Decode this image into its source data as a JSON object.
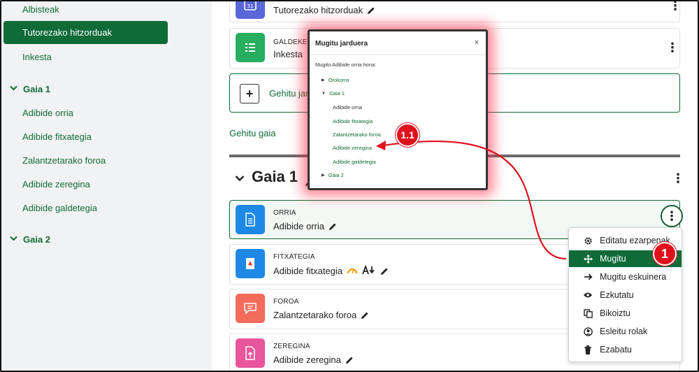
{
  "sidebar": {
    "items": [
      {
        "label": "Albisteak"
      },
      {
        "label": "Tutorezako hitzorduak"
      },
      {
        "label": "Inkesta"
      }
    ],
    "sections": [
      {
        "label": "Gaia 1",
        "items": [
          "Adibide orria",
          "Adibide fitxategia",
          "Zalantzetarako foroa",
          "Adibide zeregina",
          "Adibide galdetegia"
        ]
      },
      {
        "label": "Gaia 2"
      }
    ]
  },
  "main": {
    "top_activity": {
      "name": "Tutorezako hitzorduak"
    },
    "galdeketa": {
      "type": "GALDEKET",
      "name": "Inkesta"
    },
    "add_activity_label": "Gehitu jar",
    "add_section_label": "Gehitu gaia",
    "section_title": "Gaia 1",
    "activities": [
      {
        "type": "ORRIA",
        "name": "Adibide orria",
        "color": "#1e88e5"
      },
      {
        "type": "FITXATEGIA",
        "name": "Adibide fitxategia",
        "color": "#1e88e5"
      },
      {
        "type": "FOROA",
        "name": "Zalantzetarako foroa",
        "color": "#f26b5b"
      },
      {
        "type": "ZEREGINA",
        "name": "Adibide zeregina",
        "color": "#e9559a"
      }
    ]
  },
  "menu": {
    "items": [
      {
        "label": "Editatu ezarpenak",
        "icon": "gear-icon"
      },
      {
        "label": "Mugitu",
        "icon": "move-icon"
      },
      {
        "label": "Mugitu eskuinera",
        "icon": "arrow-right-icon"
      },
      {
        "label": "Ezkutatu",
        "icon": "eye-icon"
      },
      {
        "label": "Bikoiztu",
        "icon": "copy-icon"
      },
      {
        "label": "Esleitu rolak",
        "icon": "user-icon"
      },
      {
        "label": "Ezabatu",
        "icon": "trash-icon"
      }
    ]
  },
  "modal": {
    "title": "Mugitu jarduera",
    "close": "×",
    "prompt": "Mugitu Adibide orria hona:",
    "tree": [
      {
        "label": "Orokorra"
      },
      {
        "label": "Gaia 1"
      },
      {
        "label": "Adibide orria"
      },
      {
        "label": "Adibide fitxategia"
      },
      {
        "label": "Zalantzetarako foroa"
      },
      {
        "label": "Adibide zeregina"
      },
      {
        "label": "Adibide galdetegia"
      },
      {
        "label": "Gaia 2"
      }
    ]
  },
  "annotations": {
    "step1": "1",
    "step11": "1.1"
  },
  "colors": {
    "brand": "#0f6b37",
    "highlight": "#e0101e"
  }
}
